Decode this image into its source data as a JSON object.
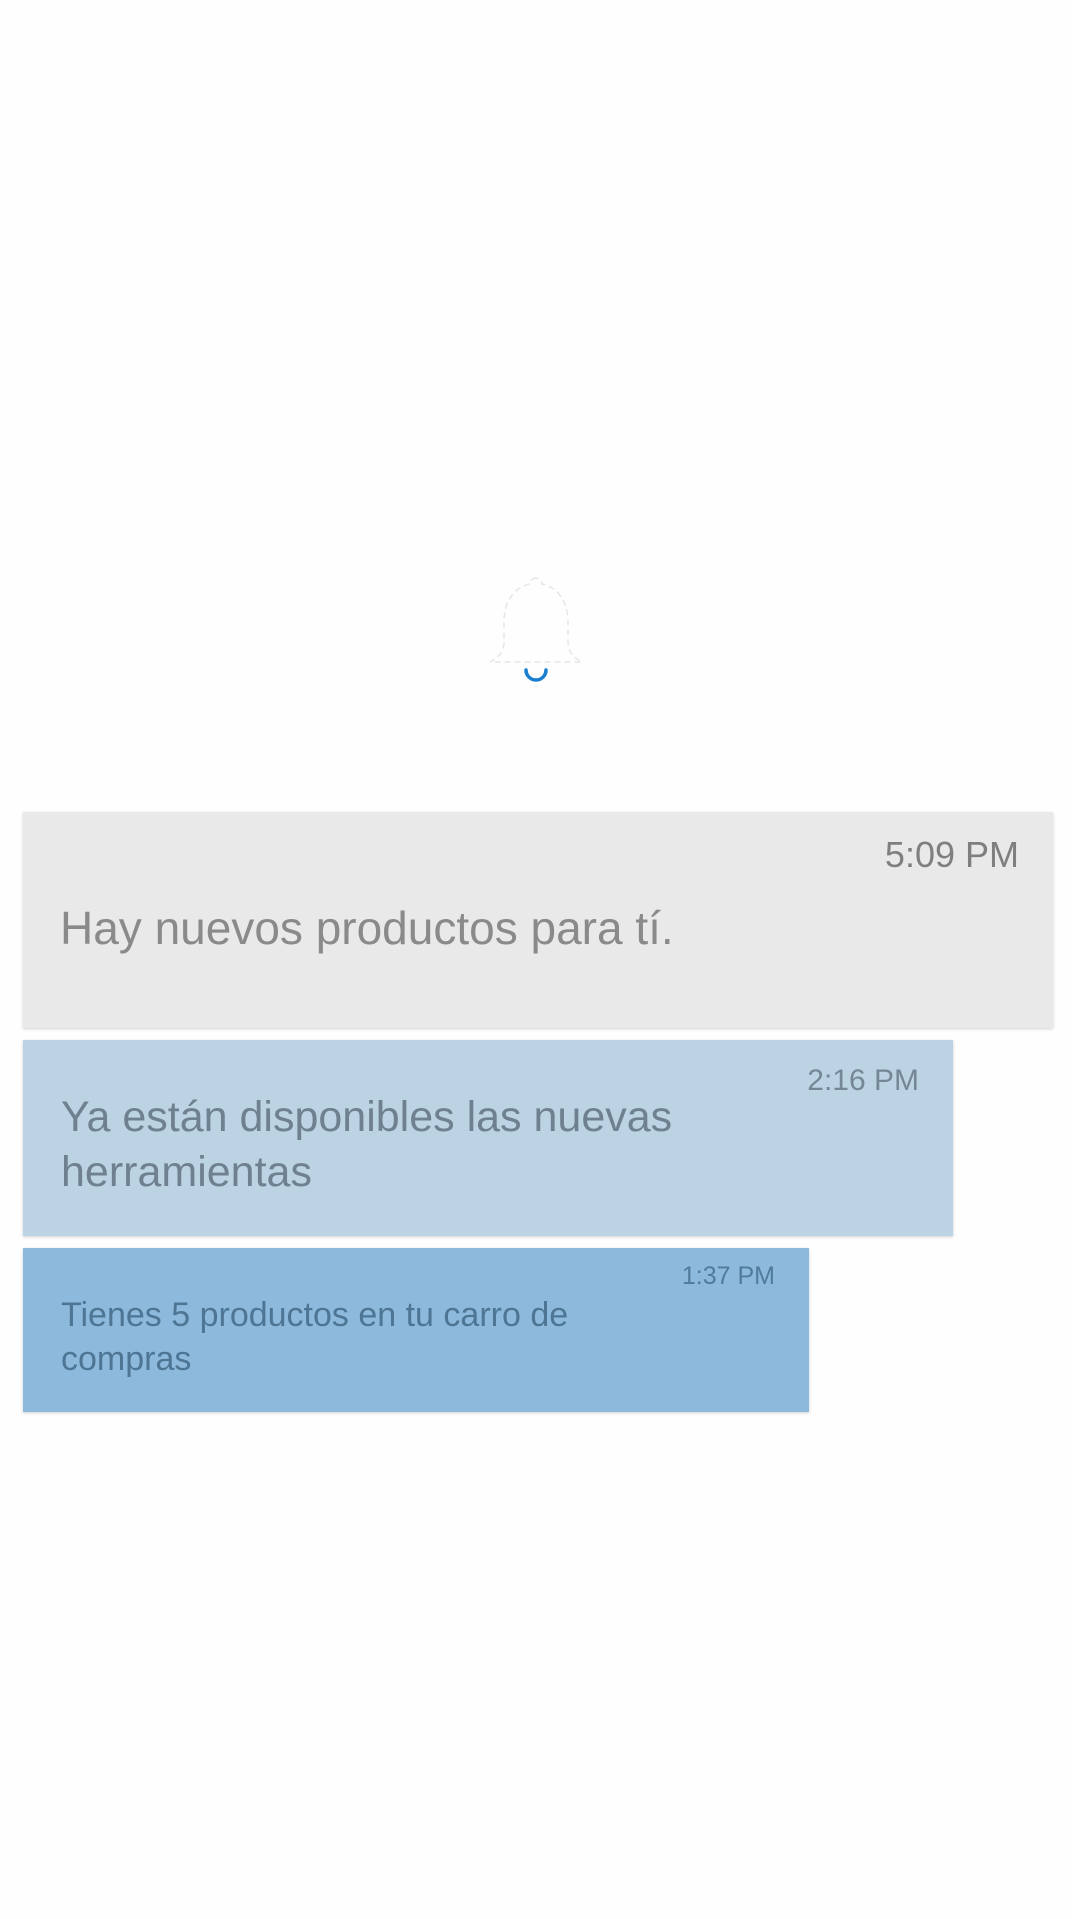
{
  "header_icon": {
    "name": "bell-icon",
    "accent": "#1a7fd0"
  },
  "notifications": [
    {
      "time": "5:09 PM",
      "message": "Hay nuevos productos para tí.",
      "background": "#e9e9e9"
    },
    {
      "time": "2:16 PM",
      "message": "Ya están disponibles las nuevas herramientas",
      "background": "#bcd3e4"
    },
    {
      "time": "1:37 PM",
      "message": "Tienes 5 productos en tu carro de compras",
      "background": "#8dbadc"
    }
  ]
}
